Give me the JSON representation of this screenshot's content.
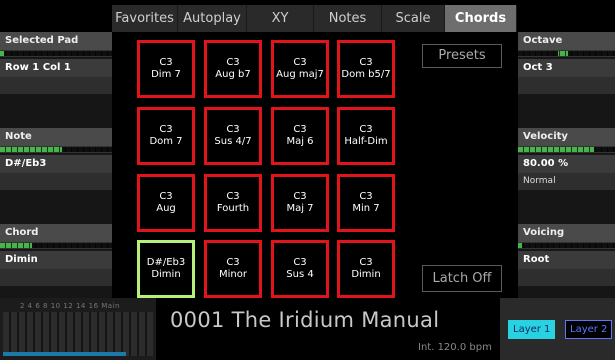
{
  "tabs": [
    "Favorites",
    "Autoplay",
    "XY",
    "Notes",
    "Scale",
    "Chords"
  ],
  "active_tab": "Chords",
  "left_panel": {
    "selected_pad": {
      "label": "Selected Pad",
      "value": "Row 1 Col 1"
    },
    "note": {
      "label": "Note",
      "value": "D#/Eb3"
    },
    "chord": {
      "label": "Chord",
      "value": "Dimin"
    }
  },
  "right_panel": {
    "octave": {
      "label": "Octave",
      "value": "Oct 3"
    },
    "velocity": {
      "label": "Velocity",
      "value": "80.00 %",
      "mode": "Normal"
    },
    "voicing": {
      "label": "Voicing",
      "value": "Root"
    }
  },
  "pads": [
    {
      "note": "C3",
      "chord": "Dim 7"
    },
    {
      "note": "C3",
      "chord": "Aug b7"
    },
    {
      "note": "C3",
      "chord": "Aug maj7"
    },
    {
      "note": "C3",
      "chord": "Dom b5/7"
    },
    {
      "note": "C3",
      "chord": "Dom 7"
    },
    {
      "note": "C3",
      "chord": "Sus 4/7"
    },
    {
      "note": "C3",
      "chord": "Maj 6"
    },
    {
      "note": "C3",
      "chord": "Half-Dim"
    },
    {
      "note": "C3",
      "chord": "Aug"
    },
    {
      "note": "C3",
      "chord": "Fourth"
    },
    {
      "note": "C3",
      "chord": "Maj 7"
    },
    {
      "note": "C3",
      "chord": "Min 7"
    },
    {
      "note": "D#/Eb3",
      "chord": "Dimin",
      "selected": true
    },
    {
      "note": "C3",
      "chord": "Minor"
    },
    {
      "note": "C3",
      "chord": "Sus 4"
    },
    {
      "note": "C3",
      "chord": "Dimin"
    }
  ],
  "buttons": {
    "presets": "Presets",
    "latch": "Latch Off"
  },
  "bottom": {
    "mixer_scale": "2  4  6  8  10  12  14  16  Main",
    "patch_title": "0001 The Iridium Manual",
    "tempo": "Int. 120.0 bpm",
    "layer1": "Layer 1",
    "layer2": "Layer 2"
  },
  "colors": {
    "pad_border": "#e0141a",
    "selected_pad_border": "#b6f07a",
    "meter": "#46b64a",
    "layer_active": "#29d2e0",
    "layer_inactive": "#5a78ff"
  }
}
